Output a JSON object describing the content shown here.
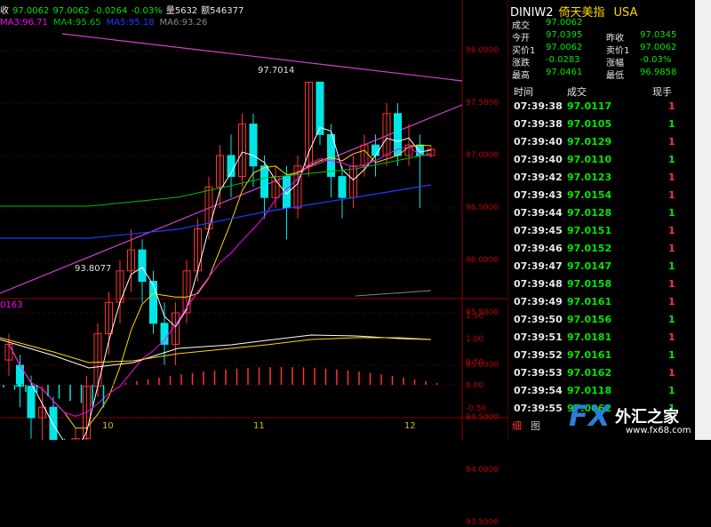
{
  "info_bar": {
    "prefix": "收",
    "close": "97.0062",
    "open": "97.0062",
    "change": "-0.0264",
    "pct": "-0.03%",
    "volume": "量5632",
    "amount": "额546377"
  },
  "ma_bar": {
    "ma3": "MA3:96.71",
    "ma4": "MA4:95.65",
    "ma5": "MA5:95.18",
    "ma6": "MA6:93.26"
  },
  "sub_value": "0163",
  "y_axis_main": [
    "98.0000",
    "97.5000",
    "97.0000",
    "96.5000",
    "96.0000",
    "95.5000",
    "95.0000",
    "94.5000",
    "94.0000",
    "93.5000"
  ],
  "y_axis_sub": [
    "1.50",
    "1.00",
    "0.50",
    "0.00",
    "-0.50"
  ],
  "x_axis": [
    "10",
    "11",
    "12"
  ],
  "annotations": {
    "high": "97.7014",
    "low": "93.8077"
  },
  "quote": {
    "symbol": "DINIW2",
    "name": "倚天美指",
    "market": "USA",
    "rows": [
      {
        "l1": "成交",
        "v1": "97.0062",
        "l2": "",
        "v2": ""
      },
      {
        "l1": "今开",
        "v1": "97.0395",
        "l2": "昨收",
        "v2": "97.0345"
      },
      {
        "l1": "买价1",
        "v1": "97.0062",
        "l2": "卖价1",
        "v2": "97.0062"
      },
      {
        "l1": "涨跌",
        "v1": "-0.0283",
        "l2": "涨幅",
        "v2": "-0.03%"
      },
      {
        "l1": "最高",
        "v1": "97.0461",
        "l2": "最低",
        "v2": "96.9858"
      }
    ],
    "trade_headers": {
      "time": "时间",
      "price": "成交",
      "qty": "现手"
    },
    "trades": [
      {
        "time": "07:39:38",
        "price": "97.0117",
        "qty": "1",
        "pc": "green",
        "qc": "red"
      },
      {
        "time": "07:39:38",
        "price": "97.0105",
        "qty": "1",
        "pc": "green",
        "qc": "green"
      },
      {
        "time": "07:39:40",
        "price": "97.0129",
        "qty": "1",
        "pc": "green",
        "qc": "red"
      },
      {
        "time": "07:39:40",
        "price": "97.0110",
        "qty": "1",
        "pc": "green",
        "qc": "green"
      },
      {
        "time": "07:39:42",
        "price": "97.0123",
        "qty": "1",
        "pc": "green",
        "qc": "red"
      },
      {
        "time": "07:39:43",
        "price": "97.0154",
        "qty": "1",
        "pc": "green",
        "qc": "red"
      },
      {
        "time": "07:39:44",
        "price": "97.0128",
        "qty": "1",
        "pc": "green",
        "qc": "green"
      },
      {
        "time": "07:39:45",
        "price": "97.0151",
        "qty": "1",
        "pc": "green",
        "qc": "red"
      },
      {
        "time": "07:39:46",
        "price": "97.0152",
        "qty": "1",
        "pc": "green",
        "qc": "red"
      },
      {
        "time": "07:39:47",
        "price": "97.0147",
        "qty": "1",
        "pc": "green",
        "qc": "green"
      },
      {
        "time": "07:39:48",
        "price": "97.0158",
        "qty": "1",
        "pc": "green",
        "qc": "red"
      },
      {
        "time": "07:39:49",
        "price": "97.0161",
        "qty": "1",
        "pc": "green",
        "qc": "red"
      },
      {
        "time": "07:39:50",
        "price": "97.0156",
        "qty": "1",
        "pc": "green",
        "qc": "green"
      },
      {
        "time": "07:39:51",
        "price": "97.0181",
        "qty": "1",
        "pc": "green",
        "qc": "red"
      },
      {
        "time": "07:39:52",
        "price": "97.0161",
        "qty": "1",
        "pc": "green",
        "qc": "green"
      },
      {
        "time": "07:39:53",
        "price": "97.0162",
        "qty": "1",
        "pc": "green",
        "qc": "red"
      },
      {
        "time": "07:39:54",
        "price": "97.0118",
        "qty": "1",
        "pc": "green",
        "qc": "green"
      },
      {
        "time": "07:39:55",
        "price": "97.0062",
        "qty": "1",
        "pc": "green",
        "qc": "green"
      }
    ]
  },
  "tabs": [
    "细",
    "图"
  ],
  "logo": {
    "fx": "FX",
    "cn": "外汇之家",
    "url": "www.fx68.com"
  },
  "colors": {
    "up": "#ff3232",
    "down": "#00e6e6",
    "ma3": "#ffffff",
    "ma4": "#ffd700",
    "ma5": "#ff00ff",
    "ma6": "#00c000",
    "ma7": "#1e3cff",
    "trend": "#d040d0"
  }
}
